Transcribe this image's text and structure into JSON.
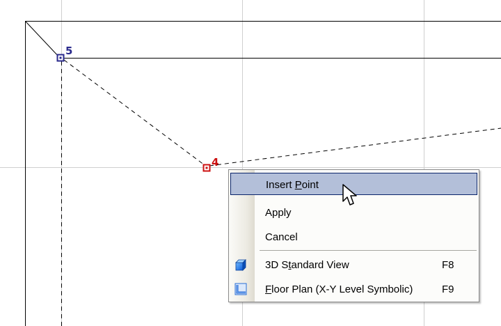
{
  "drawing": {
    "points": [
      {
        "label": "5",
        "color": "#2a2a8c"
      },
      {
        "label": "4",
        "color": "#cc1111"
      }
    ]
  },
  "context_menu": {
    "items": [
      {
        "label_pre": "Insert ",
        "accel": "P",
        "label_post": "oint",
        "shortcut": "",
        "highlighted": true
      },
      {
        "label_pre": "Apply",
        "accel": "",
        "label_post": "",
        "shortcut": ""
      },
      {
        "label_pre": "Cancel",
        "accel": "",
        "label_post": "",
        "shortcut": ""
      },
      {
        "label_pre": "3D S",
        "accel": "t",
        "label_post": "andard View",
        "shortcut": "F8",
        "icon": "cube-icon"
      },
      {
        "label_pre": "",
        "accel": "F",
        "label_post": "loor Plan (X-Y Level Symbolic)",
        "shortcut": "F9",
        "icon": "floor-plan-icon"
      }
    ]
  },
  "colors": {
    "menu_highlight": "#b3bfd9",
    "menu_highlight_border": "#0a246a",
    "grid_line": "#cfcfcf",
    "point_5": "#2a2a8c",
    "point_4": "#cc1111"
  }
}
